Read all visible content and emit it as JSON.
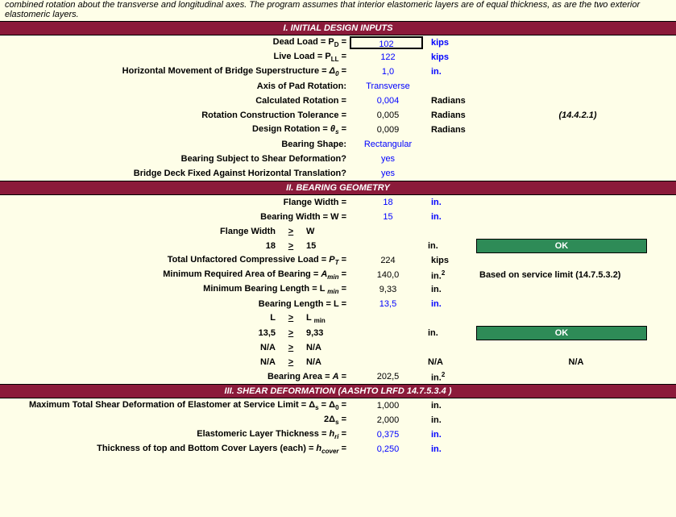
{
  "intro": "combined rotation about the transverse and longitudinal axes.  The program assumes that interior elastomeric layers are of equal thickness, as are the two exterior elastomeric layers.",
  "sections": {
    "s1": "I.  INITIAL DESIGN INPUTS",
    "s2": "II.  BEARING GEOMETRY",
    "s3": "III.  SHEAR DEFORMATION (AASHTO LRFD 14.7.5.3.4 )"
  },
  "r1": {
    "label_a": "Dead Load = P",
    "label_b": "D",
    "label_c": " =",
    "value": "102",
    "unit": "kips"
  },
  "r2": {
    "label_a": "Live Load = P",
    "label_b": "LL",
    "label_c": " =",
    "value": "122",
    "unit": "kips"
  },
  "r3": {
    "label_a": "Horizontal Movement of Bridge Superstructure = ",
    "label_i": "Δ",
    "label_b": "0",
    "label_c": " =",
    "value": "1,0",
    "unit": "in."
  },
  "r4": {
    "label": "Axis of Pad Rotation:",
    "value": "Transverse"
  },
  "r5": {
    "label": "Calculated Rotation =",
    "value": "0,004",
    "unit": "Radians"
  },
  "r6": {
    "label": "Rotation Construction Tolerance =",
    "value": "0,005",
    "unit": "Radians",
    "ref": "(14.4.2.1)"
  },
  "r7": {
    "label_a": "Design Rotation = ",
    "label_i": "θ",
    "label_b": "s",
    "label_c": " =",
    "value": "0,009",
    "unit": "Radians"
  },
  "r8": {
    "label": "Bearing Shape:",
    "value": "Rectangular"
  },
  "r9": {
    "label": "Bearing Subject to Shear Deformation?",
    "value": "yes"
  },
  "r10": {
    "label": "Bridge Deck Fixed Against Horizontal Translation?",
    "value": "yes"
  },
  "g1": {
    "label": "Flange Width =",
    "value": "18",
    "unit": "in."
  },
  "g2": {
    "label": "Bearing Width = W =",
    "value": "15",
    "unit": "in."
  },
  "g3": {
    "label_a": "Flange Width",
    "op": ">",
    "label_b": "W"
  },
  "g4": {
    "left": "18",
    "op": ">",
    "right": "15",
    "unit": "in.",
    "ok": "OK"
  },
  "g5": {
    "label_a": "Total Unfactored Compressive Load = ",
    "label_i": "P",
    "label_b": "T",
    "label_c": " =",
    "value": "224",
    "unit": "kips"
  },
  "g6": {
    "label_a": "Minimum Required Area of Bearing = ",
    "label_i": "A",
    "label_b": "min",
    "label_c": " =",
    "value": "140,0",
    "unit_a": "in.",
    "unit_b": "2",
    "note": "Based on service limit (14.7.5.3.2)"
  },
  "g7": {
    "label_a": "Minimum Bearing Length = L ",
    "label_b": "min",
    "label_c": " =",
    "value": "9,33",
    "unit": "in."
  },
  "g8": {
    "label": "Bearing Length = L =",
    "value": "13,5",
    "unit": "in."
  },
  "g9": {
    "left": "L",
    "op": ">",
    "right_a": "L",
    "right_b": "min"
  },
  "g10": {
    "left": "13,5",
    "op": ">",
    "right": "9,33",
    "unit": "in.",
    "ok": "OK"
  },
  "g11": {
    "left": "N/A",
    "op": ">",
    "right": "N/A"
  },
  "g12": {
    "left": "N/A",
    "op": ">",
    "right": "N/A",
    "unit": "N/A",
    "note": "N/A"
  },
  "g13": {
    "label_a": "Bearing Area = ",
    "label_i": "A",
    "label_c": " =",
    "value": "202,5",
    "unit_a": "in.",
    "unit_b": "2"
  },
  "d1": {
    "label_a": "Maximum Total Shear Deformation of Elastomer at Service Limit = Δ",
    "label_b": "s",
    "label_mid": " = Δ",
    "label_b2": "0",
    "label_c": " =",
    "value": "1,000",
    "unit": "in."
  },
  "d2": {
    "label_a": "2Δ",
    "label_b": "s",
    "label_c": " =",
    "value": "2,000",
    "unit": "in."
  },
  "d3": {
    "label_a": "Elastomeric Layer Thickness = ",
    "label_i": "h",
    "label_b": "ri",
    "label_c": " =",
    "value": "0,375",
    "unit": "in."
  },
  "d4": {
    "label_a": "Thickness of top and Bottom Cover Layers (each)  = ",
    "label_i": "h",
    "label_b": "cover",
    "label_c": " =",
    "value": "0,250",
    "unit": "in."
  }
}
